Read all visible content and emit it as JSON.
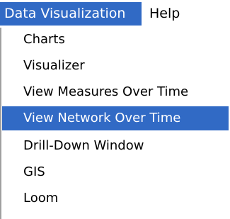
{
  "colors": {
    "highlight": "#316ac5",
    "menu_edge": "#a0a0a0"
  },
  "menubar": {
    "items": [
      {
        "label": "Data Visualization",
        "active": true
      },
      {
        "label": "Help",
        "active": false
      }
    ]
  },
  "dropdown": {
    "items": [
      {
        "label": "Charts",
        "selected": false
      },
      {
        "label": "Visualizer",
        "selected": false
      },
      {
        "label": "View Measures Over Time",
        "selected": false
      },
      {
        "label": "View Network Over Time",
        "selected": true
      },
      {
        "label": "Drill-Down Window",
        "selected": false
      },
      {
        "label": "GIS",
        "selected": false
      },
      {
        "label": "Loom",
        "selected": false
      }
    ]
  }
}
